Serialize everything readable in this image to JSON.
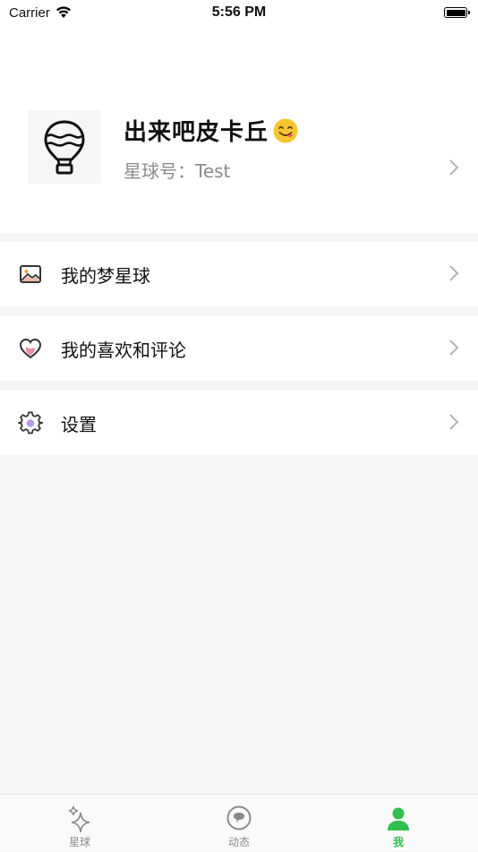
{
  "status_bar": {
    "carrier": "Carrier",
    "time": "5:56 PM"
  },
  "profile": {
    "name": "出来吧皮卡丘",
    "id_label": "星球号：",
    "id_value": "Test"
  },
  "menu": [
    {
      "label": "我的梦星球",
      "icon": "image-icon"
    },
    {
      "label": "我的喜欢和评论",
      "icon": "heart-icon"
    },
    {
      "label": "设置",
      "icon": "gear-icon"
    }
  ],
  "tabs": [
    {
      "label": "星球",
      "icon": "sparkle-icon",
      "active": false
    },
    {
      "label": "动态",
      "icon": "chat-bubble-icon",
      "active": false
    },
    {
      "label": "我",
      "icon": "person-icon",
      "active": true
    }
  ],
  "colors": {
    "accent": "#2fbf4f",
    "background": "#f5f5f5",
    "secondary_text": "#8a8a8a",
    "inactive_tab": "#8a8a8a"
  }
}
